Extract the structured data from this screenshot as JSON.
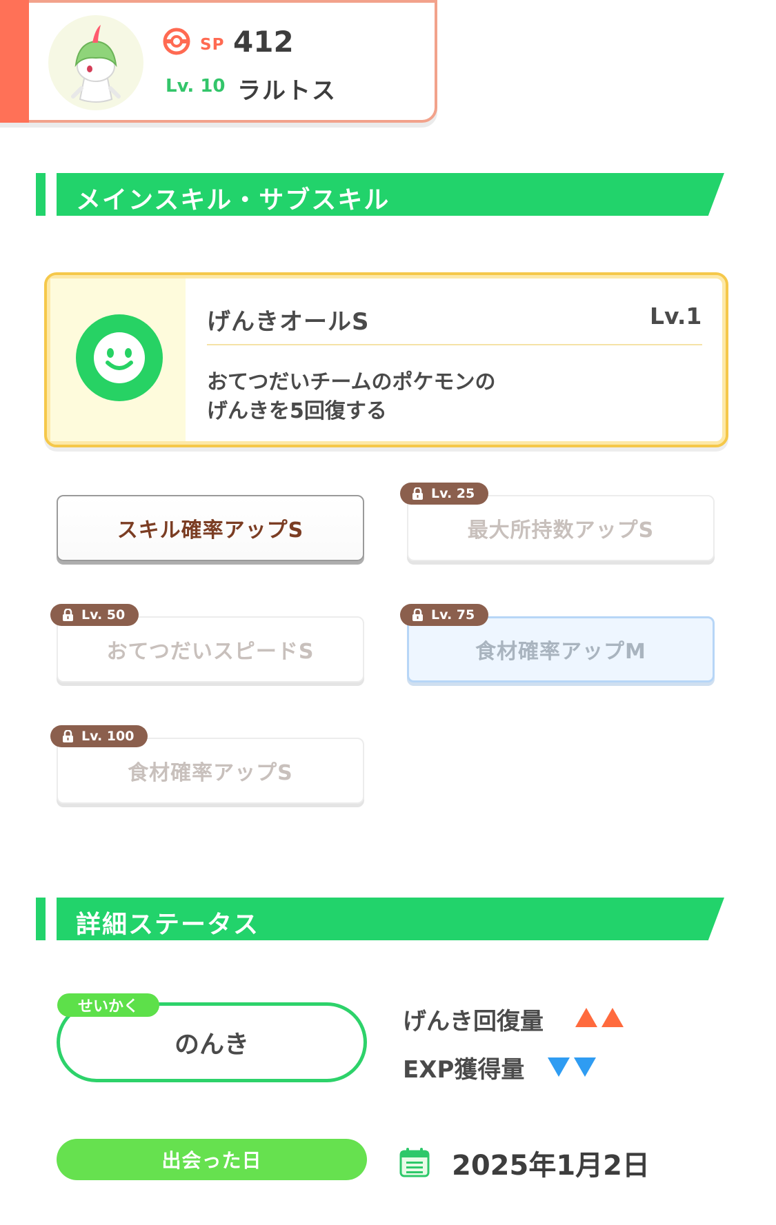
{
  "header": {
    "sp_label": "SP",
    "sp_value": "412",
    "level": "Lv. 10",
    "name": "ラルトス"
  },
  "section_skills": {
    "title": "メインスキル・サブスキル"
  },
  "main_skill": {
    "name": "げんきオールS",
    "level": "Lv.1",
    "desc_line1": "おてつだいチームのポケモンの",
    "desc_line2": "げんきを5回復する",
    "icon": "smile-face-icon"
  },
  "sub_skills": [
    {
      "label": "スキル確率アップS",
      "unlocked": true
    },
    {
      "label": "最大所持数アップS",
      "lock": "Lv. 25"
    },
    {
      "label": "おてつだいスピードS",
      "lock": "Lv. 50"
    },
    {
      "label": "食材確率アップM",
      "lock": "Lv. 75"
    },
    {
      "label": "食材確率アップS",
      "lock": "Lv. 100"
    }
  ],
  "section_status": {
    "title": "詳細ステータス"
  },
  "nature": {
    "tag": "せいかく",
    "value": "のんき",
    "up_label": "げんき回復量",
    "down_label": "EXP獲得量"
  },
  "met": {
    "label": "出会った日",
    "date": "2025年1月2日"
  },
  "colors": {
    "accent_green": "#22d36b",
    "header_orange": "#ff7157",
    "stat_up": "#ff6a3d",
    "stat_down": "#2f9cf2"
  }
}
